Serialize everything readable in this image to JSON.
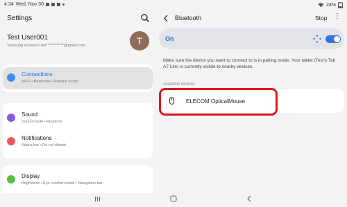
{
  "status_bar": {
    "time": "4:34",
    "date": "Wed, Nov 30",
    "battery": "24%"
  },
  "left_pane": {
    "title": "Settings",
    "profile": {
      "name": "Test User001",
      "account": "Samsung account  •  tes************@gmail.com",
      "avatar_letter": "T"
    },
    "items": [
      {
        "title": "Connections",
        "subtitle": "Wi-Fi  •  Bluetooth  •  Airplane mode",
        "icon": "wifi-icon",
        "color": "#3b8ef0",
        "selected": true
      },
      {
        "title": "Sound",
        "subtitle": "Sound mode  •  Ringtone",
        "icon": "sound-icon",
        "color": "#8a5ae6"
      },
      {
        "title": "Notifications",
        "subtitle": "Status bar  •  Do not disturb",
        "icon": "notifications-icon",
        "color": "#ec5a5a"
      },
      {
        "title": "Display",
        "subtitle": "Brightness  •  Eye comfort shield  •  Navigation bar",
        "icon": "display-icon",
        "color": "#5bbf3b"
      }
    ]
  },
  "right_pane": {
    "title": "Bluetooth",
    "stop_label": "Stop",
    "toggle": {
      "label": "On",
      "state": true,
      "accent": "#3670de"
    },
    "description": "Make sure the device you want to connect to is in pairing mode. Your tablet (Test's Tab A7 Lite) is currently visible to nearby devices.",
    "available_label": "Available devices",
    "devices": [
      {
        "name": "ELECOM OpticalMouse",
        "icon": "mouse-icon"
      }
    ]
  },
  "highlight_color": "#e0141c"
}
